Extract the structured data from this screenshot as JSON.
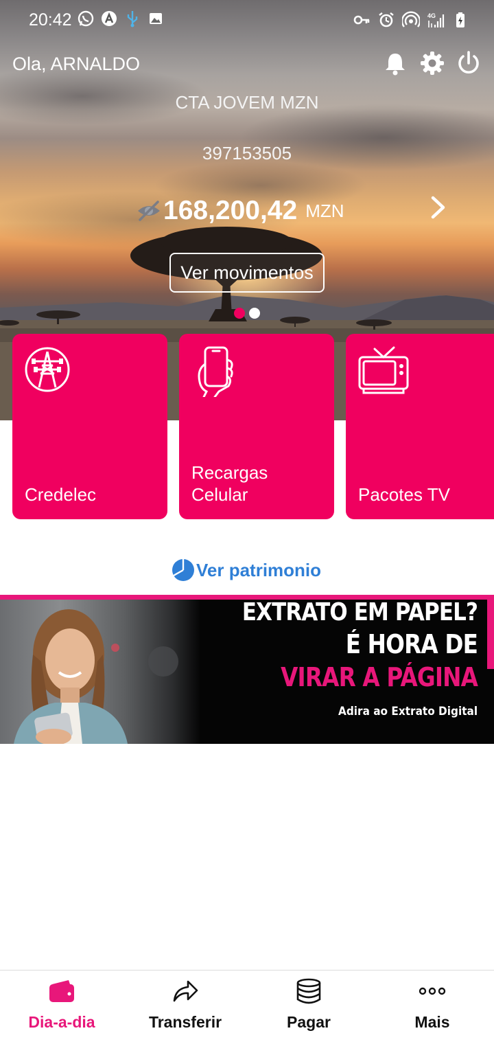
{
  "status_bar": {
    "time": "20:42",
    "network": "4G"
  },
  "header": {
    "greeting": "Ola, ARNALDO"
  },
  "account": {
    "name": "CTA JOVEM MZN",
    "number": "397153505",
    "balance": "168,200,42",
    "currency": "MZN",
    "movements_button": "Ver movimentos",
    "carousel_pages": 2,
    "carousel_active": 1
  },
  "cards": [
    {
      "label": "Credelec",
      "icon": "electricity-tower-icon"
    },
    {
      "label": "Recargas Celular",
      "icon": "phone-hand-icon"
    },
    {
      "label": "Pacotes TV",
      "icon": "tv-icon"
    }
  ],
  "patrimonio": {
    "label": "Ver patrimonio",
    "icon": "pie-chart-icon"
  },
  "banner": {
    "line1": "EXTRATO EM PAPEL?",
    "line2": "É HORA DE",
    "line3": "VIRAR A PÁGINA",
    "line4": "Adira ao Extrato Digital"
  },
  "bottom_nav": [
    {
      "label": "Dia-a-dia",
      "icon": "wallet-icon",
      "active": true
    },
    {
      "label": "Transferir",
      "icon": "share-arrow-icon",
      "active": false
    },
    {
      "label": "Pagar",
      "icon": "coins-stack-icon",
      "active": false
    },
    {
      "label": "Mais",
      "icon": "more-dots-icon",
      "active": false
    }
  ],
  "colors": {
    "brand_pink": "#f0005f",
    "link_blue": "#2f7fd6",
    "nav_active": "#e8177a"
  }
}
